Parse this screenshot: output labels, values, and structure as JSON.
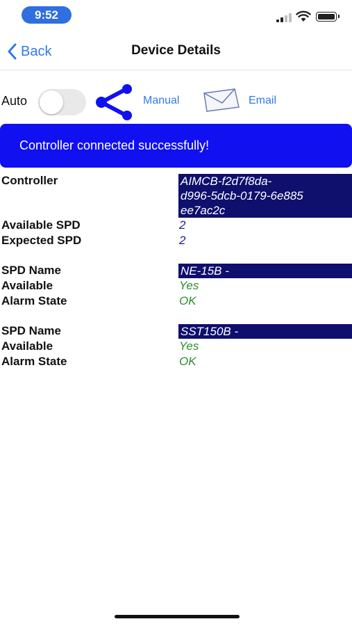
{
  "status_bar": {
    "time": "9:52"
  },
  "nav": {
    "back_label": "Back",
    "title": "Device Details"
  },
  "toolbar": {
    "auto_label": "Auto",
    "auto_on": false,
    "manual_label": "Manual",
    "email_label": "Email"
  },
  "banner": {
    "message": "Controller connected successfully!"
  },
  "controller": {
    "label": "Controller",
    "id_lines": [
      "AIMCB-f2d7f8da-",
      "d996-5dcb-0179-6e885",
      "ee7ac2c"
    ]
  },
  "summary": {
    "available_label": "Available SPD",
    "available_value": "2",
    "expected_label": "Expected SPD",
    "expected_value": "2"
  },
  "spds": [
    {
      "name_label": "SPD Name",
      "name": "NE-15B  -",
      "available_label": "Available",
      "available": "Yes",
      "alarm_label": "Alarm State",
      "alarm": "OK"
    },
    {
      "name_label": "SPD Name",
      "name": "SST150B -",
      "available_label": "Available",
      "available": "Yes",
      "alarm_label": "Alarm State",
      "alarm": "OK"
    }
  ],
  "colors": {
    "accent": "#2f7be5",
    "banner": "#1010f0",
    "highlight": "#0f0f6e",
    "ok_green": "#2e8b2e"
  }
}
